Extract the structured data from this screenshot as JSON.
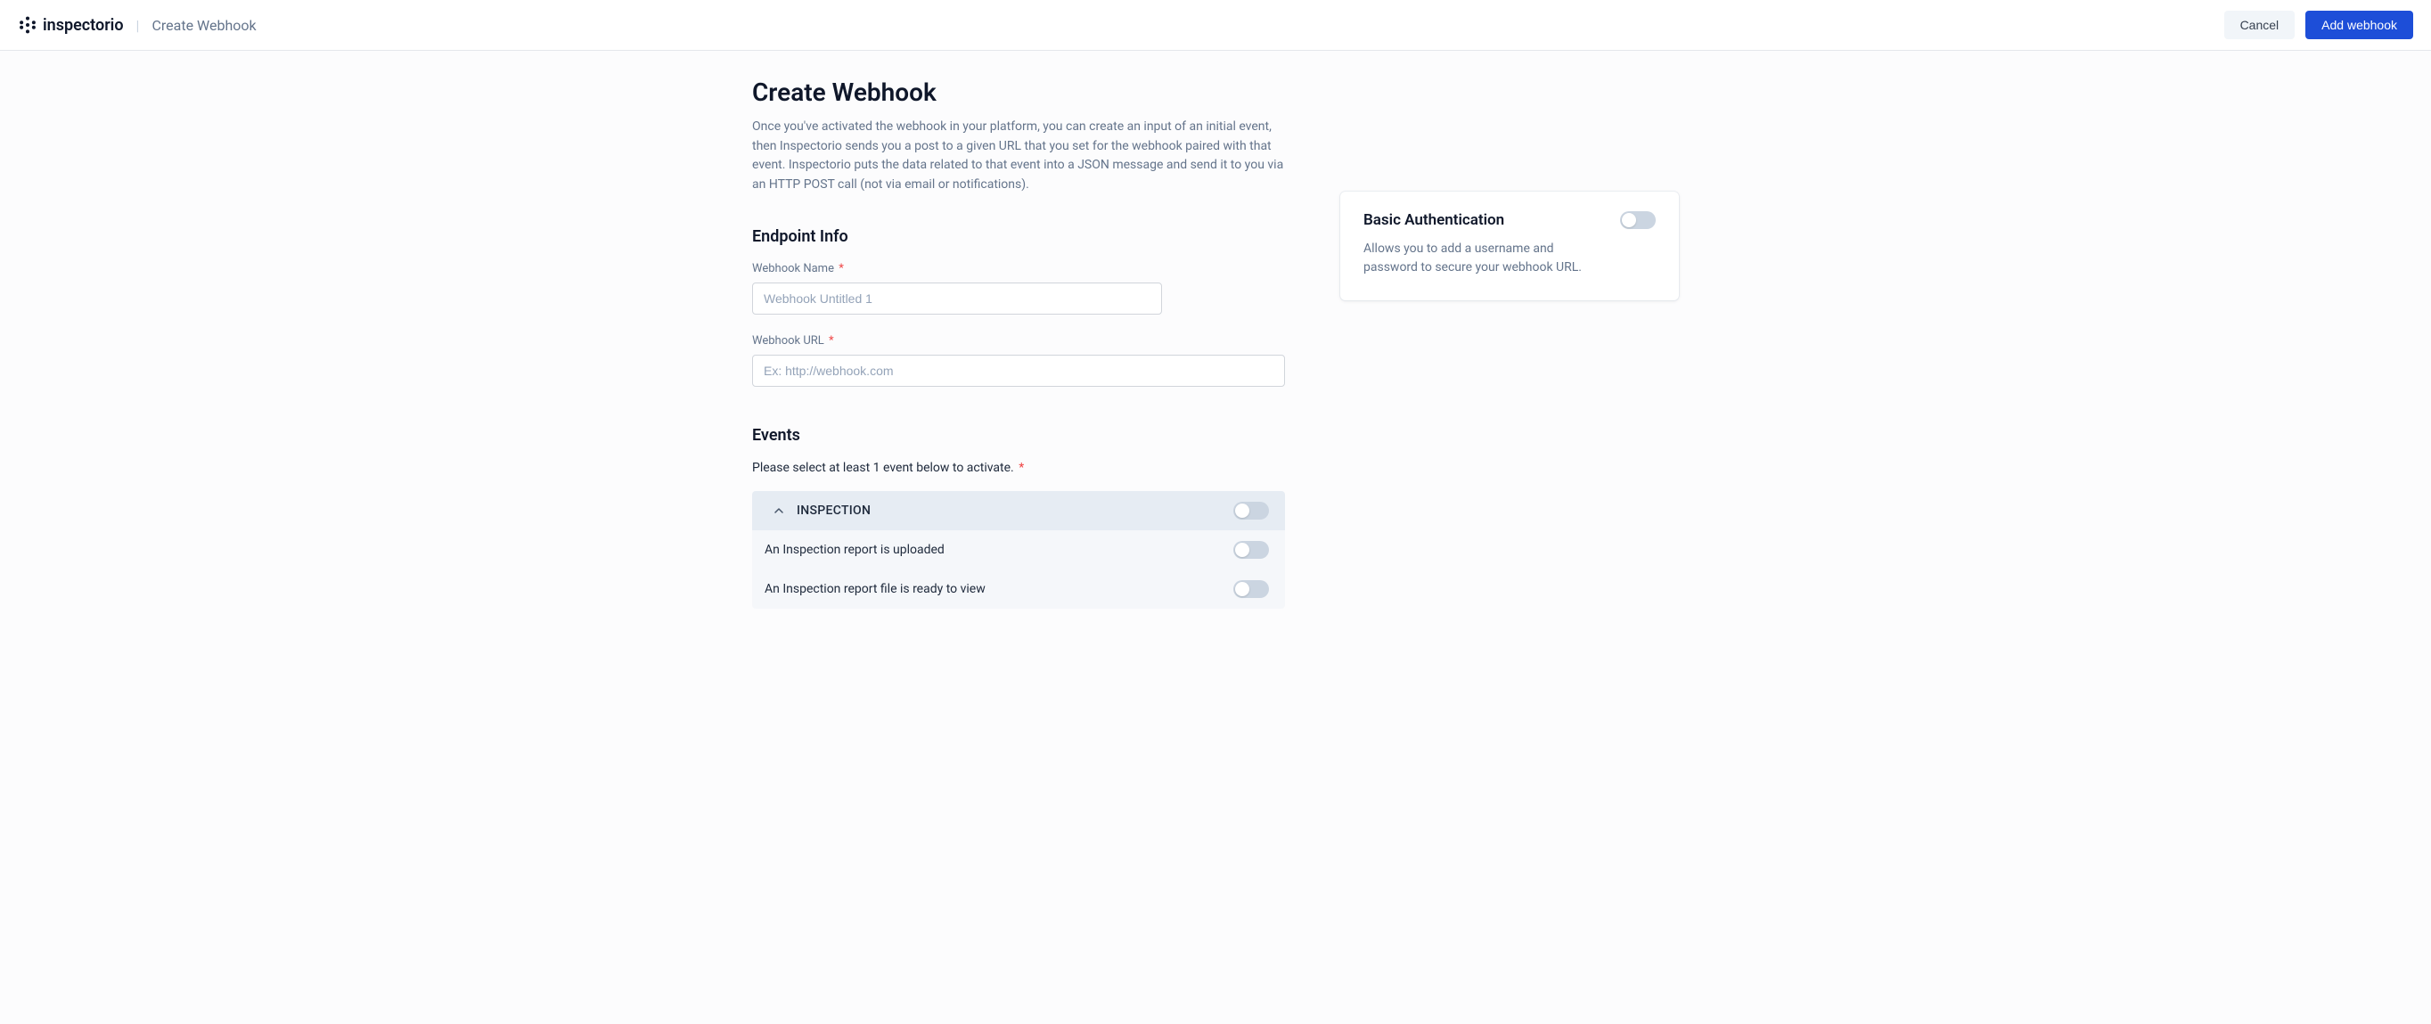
{
  "header": {
    "brand": "inspectorio",
    "breadcrumb": "Create Webhook",
    "cancel_label": "Cancel",
    "add_label": "Add webhook"
  },
  "page": {
    "title": "Create Webhook",
    "description": "Once you've activated the webhook in your platform, you can create an input of an initial event, then Inspectorio sends you a post to a given URL that you set for the webhook paired with that event. Inspectorio puts the data related to that event into a JSON message and send it to you via an HTTP POST call (not via email or notifications)."
  },
  "endpoint": {
    "section_title": "Endpoint Info",
    "name_label": "Webhook Name",
    "name_placeholder": "Webhook Untitled 1",
    "name_value": "",
    "url_label": "Webhook URL",
    "url_placeholder": "Ex: http://webhook.com",
    "url_value": ""
  },
  "events": {
    "section_title": "Events",
    "instruction": "Please select at least 1 event below to activate.",
    "group_title": "INSPECTION",
    "items": [
      {
        "label": "An Inspection report is uploaded",
        "enabled": false
      },
      {
        "label": "An Inspection report file is ready to view",
        "enabled": false
      }
    ]
  },
  "auth": {
    "title": "Basic Authentication",
    "description": "Allows you to add a username and password to secure your webhook URL.",
    "enabled": false
  }
}
